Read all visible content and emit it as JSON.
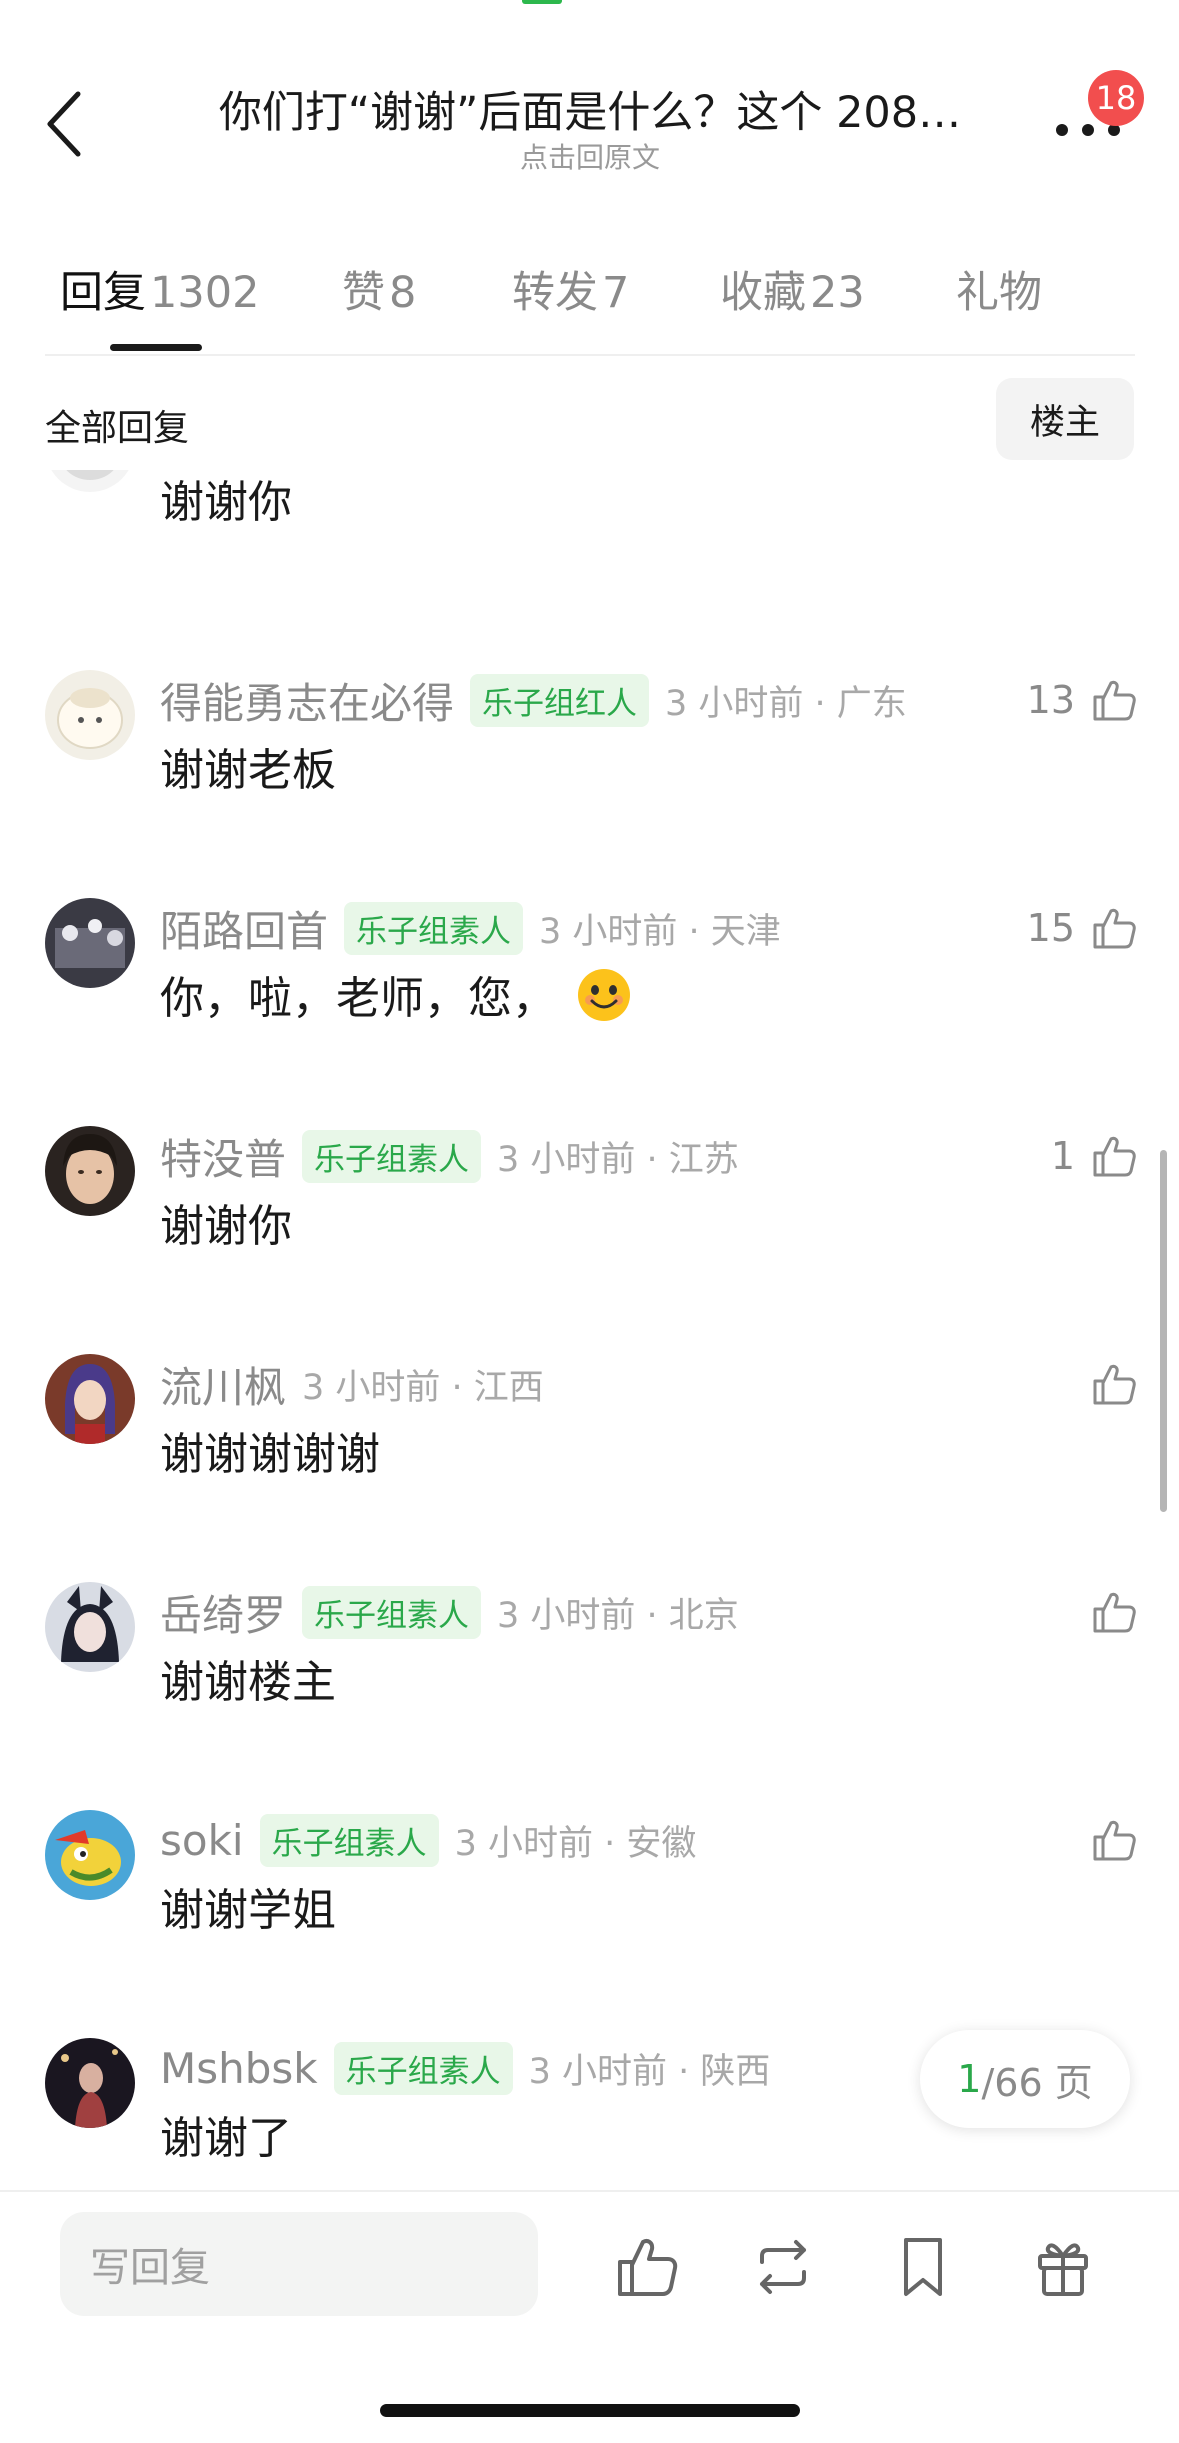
{
  "header": {
    "title": "你们打“谢谢”后面是什么？这个 208…",
    "subtitle": "点击回原文",
    "notification_count": "18"
  },
  "tabs": [
    {
      "label": "回复",
      "count": "1302"
    },
    {
      "label": "赞",
      "count": "8"
    },
    {
      "label": "转发",
      "count": "7"
    },
    {
      "label": "收藏",
      "count": "23"
    },
    {
      "label": "礼物",
      "count": ""
    }
  ],
  "filter": {
    "all_replies": "全部回复",
    "op_only": "楼主"
  },
  "comments": [
    {
      "name": "",
      "tag": "",
      "time_loc": "",
      "text": "谢谢你",
      "likes": ""
    },
    {
      "name": "得能勇志在必得",
      "tag": "乐子组红人",
      "time_loc": "3 小时前 · 广东",
      "text": "谢谢老板",
      "likes": "13"
    },
    {
      "name": "陌路回首",
      "tag": "乐子组素人",
      "time_loc": "3 小时前 · 天津",
      "text": "你，啦，老师，您，",
      "emoji": "smile",
      "likes": "15"
    },
    {
      "name": "特没普",
      "tag": "乐子组素人",
      "time_loc": "3 小时前 · 江苏",
      "text": "谢谢你",
      "likes": "1"
    },
    {
      "name": "流川枫",
      "tag": "",
      "time_loc": "3 小时前 · 江西",
      "text": "谢谢谢谢谢",
      "likes": ""
    },
    {
      "name": "岳绮罗",
      "tag": "乐子组素人",
      "time_loc": "3 小时前 · 北京",
      "text": "谢谢楼主",
      "likes": ""
    },
    {
      "name": "soki",
      "tag": "乐子组素人",
      "time_loc": "3 小时前 · 安徽",
      "text": "谢谢学姐",
      "likes": ""
    },
    {
      "name": "Mshbsk",
      "tag": "乐子组素人",
      "time_loc": "3 小时前 · 陕西",
      "text": "谢谢了",
      "likes": ""
    }
  ],
  "pager": {
    "current": "1",
    "total": "/66 页"
  },
  "bottom": {
    "reply_placeholder": "写回复"
  },
  "colors": {
    "accent": "#2aa84a",
    "tag_bg": "#e8f7e8",
    "badge": "#f24e4e"
  }
}
